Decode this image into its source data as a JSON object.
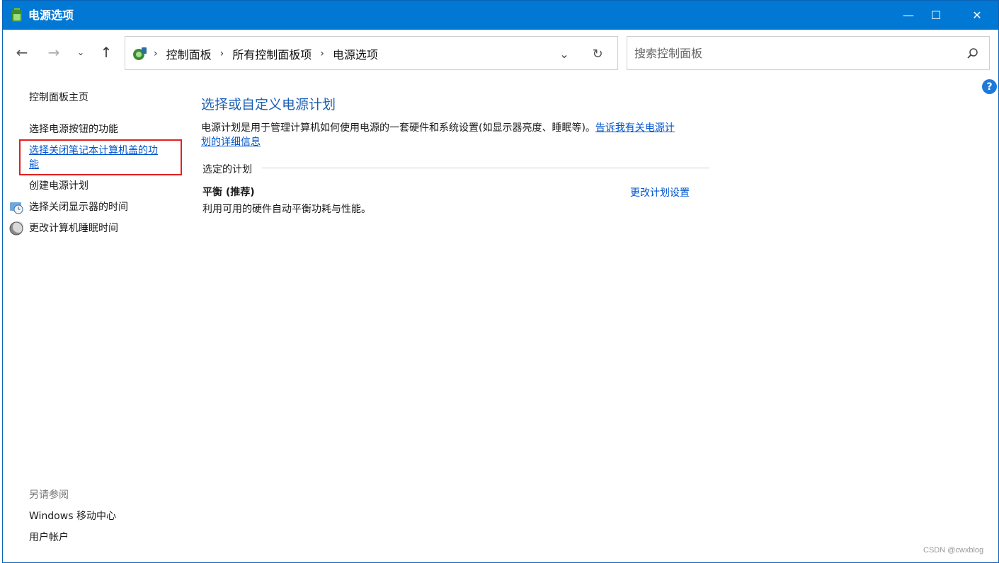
{
  "window": {
    "title": "电源选项",
    "controls": {
      "minimize": "—",
      "maximize": "☐",
      "close": "✕"
    }
  },
  "nav": {
    "back": "←",
    "forward": "→",
    "recent": "⌄",
    "up": "↑"
  },
  "address": {
    "crumbs": [
      "控制面板",
      "所有控制面板项",
      "电源选项"
    ],
    "separator": "›",
    "dropdown": "⌄",
    "refresh": "↻"
  },
  "search": {
    "placeholder": "搜索控制面板"
  },
  "help": "?",
  "sidebar": {
    "home": "控制面板主页",
    "items": [
      "选择电源按钮的功能",
      "选择关闭笔记本计算机盖的功",
      "能",
      "创建电源计划",
      "选择关闭显示器的时间",
      "更改计算机睡眠时间"
    ],
    "see_also_label": "另请参阅",
    "see_also": [
      "Windows 移动中心",
      "用户帐户"
    ]
  },
  "main": {
    "title": "选择或自定义电源计划",
    "description": "电源计划是用于管理计算机如何使用电源的一套硬件和系统设置(如显示器亮度、睡眠等)。",
    "description_link_line1": "告诉我有关电源计",
    "description_link_line2": "划的详细信息",
    "section_label": "选定的计划",
    "plan": {
      "name": "平衡 (推荐)",
      "description": "利用可用的硬件自动平衡功耗与性能。",
      "settings_link": "更改计划设置"
    }
  },
  "watermark": "CSDN @cwxblog",
  "colors": {
    "titlebar": "#0078d4",
    "link": "#0055cc",
    "heading": "#1b5fb4",
    "highlight": "#e02020"
  }
}
